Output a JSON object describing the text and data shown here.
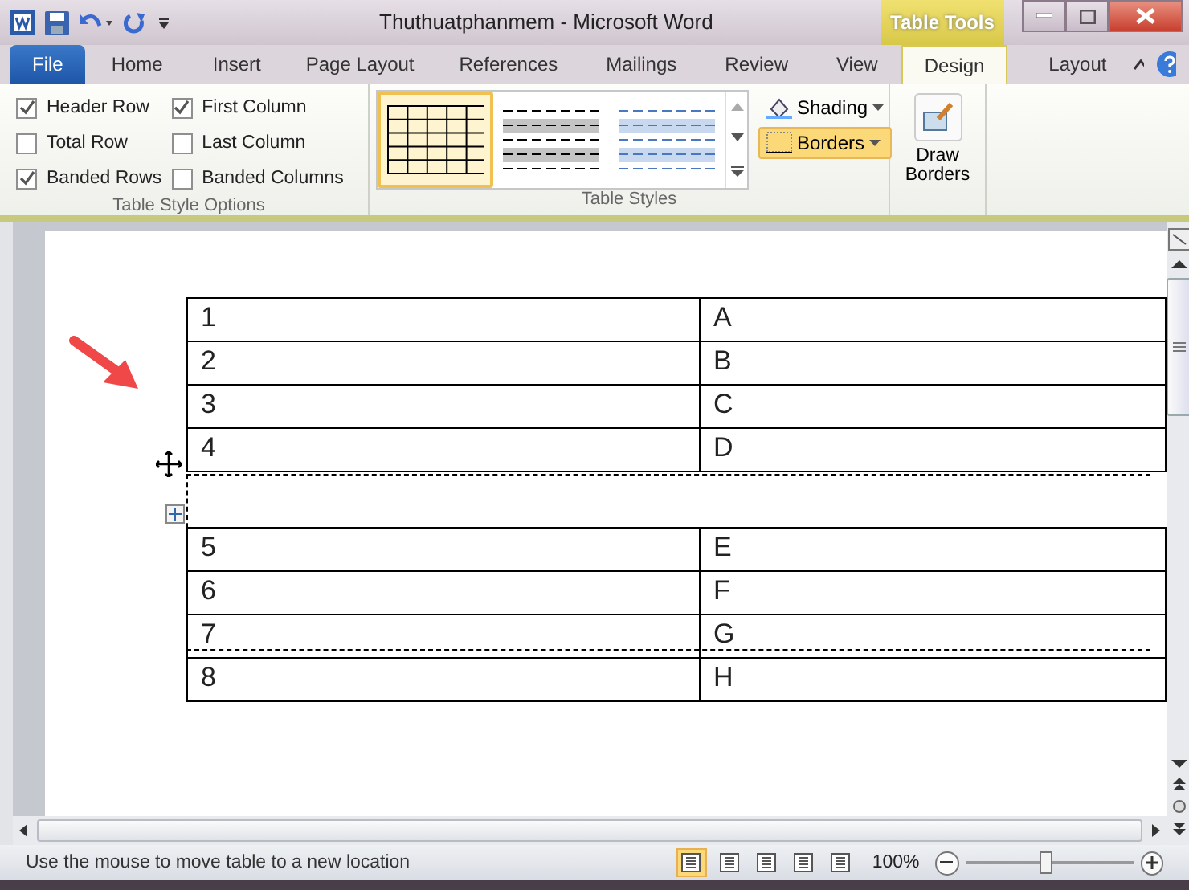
{
  "window": {
    "title": "Thuthuatphanmem - Microsoft Word",
    "context_label": "Table Tools"
  },
  "tabs": [
    {
      "label": "File",
      "kind": "file",
      "selected": false
    },
    {
      "label": "Home",
      "kind": "tab",
      "selected": false
    },
    {
      "label": "Insert",
      "kind": "tab",
      "selected": false
    },
    {
      "label": "Page Layout",
      "kind": "tab",
      "selected": false
    },
    {
      "label": "References",
      "kind": "tab",
      "selected": false
    },
    {
      "label": "Mailings",
      "kind": "tab",
      "selected": false
    },
    {
      "label": "Review",
      "kind": "tab",
      "selected": false
    },
    {
      "label": "View",
      "kind": "tab",
      "selected": false
    },
    {
      "label": "Design",
      "kind": "context",
      "selected": true
    },
    {
      "label": "Layout",
      "kind": "context",
      "selected": false
    }
  ],
  "style_options": {
    "label": "Table Style Options",
    "items": [
      {
        "label": "Header Row",
        "checked": true
      },
      {
        "label": "Total Row",
        "checked": false
      },
      {
        "label": "Banded Rows",
        "checked": true
      },
      {
        "label": "First Column",
        "checked": true
      },
      {
        "label": "Last Column",
        "checked": false
      },
      {
        "label": "Banded Columns",
        "checked": false
      }
    ]
  },
  "table_styles": {
    "label": "Table Styles",
    "gallery": [
      {
        "kind": "grid",
        "selected": true
      },
      {
        "kind": "gray",
        "selected": false
      },
      {
        "kind": "blue",
        "selected": false
      }
    ],
    "buttons": [
      {
        "label": "Shading",
        "pressed": false
      },
      {
        "label": "Borders",
        "pressed": true
      }
    ]
  },
  "draw_borders": {
    "label": "Draw Borders"
  },
  "document": {
    "rows_above": [
      {
        "column_1": "1",
        "column_2": "A"
      },
      {
        "column_1": "2",
        "column_2": "B"
      },
      {
        "column_1": "3",
        "column_2": "C"
      },
      {
        "column_1": "4",
        "column_2": "D"
      }
    ],
    "rows_below": [
      {
        "column_1": "5",
        "column_2": "E"
      },
      {
        "column_1": "6",
        "column_2": "F"
      },
      {
        "column_1": "7",
        "column_2": "G"
      },
      {
        "column_1": "8",
        "column_2": "H"
      }
    ]
  },
  "status_bar": {
    "message": "Use the mouse to move table to a new location",
    "views": [
      {
        "selected": true
      },
      {
        "selected": false
      },
      {
        "selected": false
      },
      {
        "selected": false
      },
      {
        "selected": false
      }
    ],
    "zoom": "100%",
    "zoom_slider": {
      "level": 0.48
    }
  }
}
